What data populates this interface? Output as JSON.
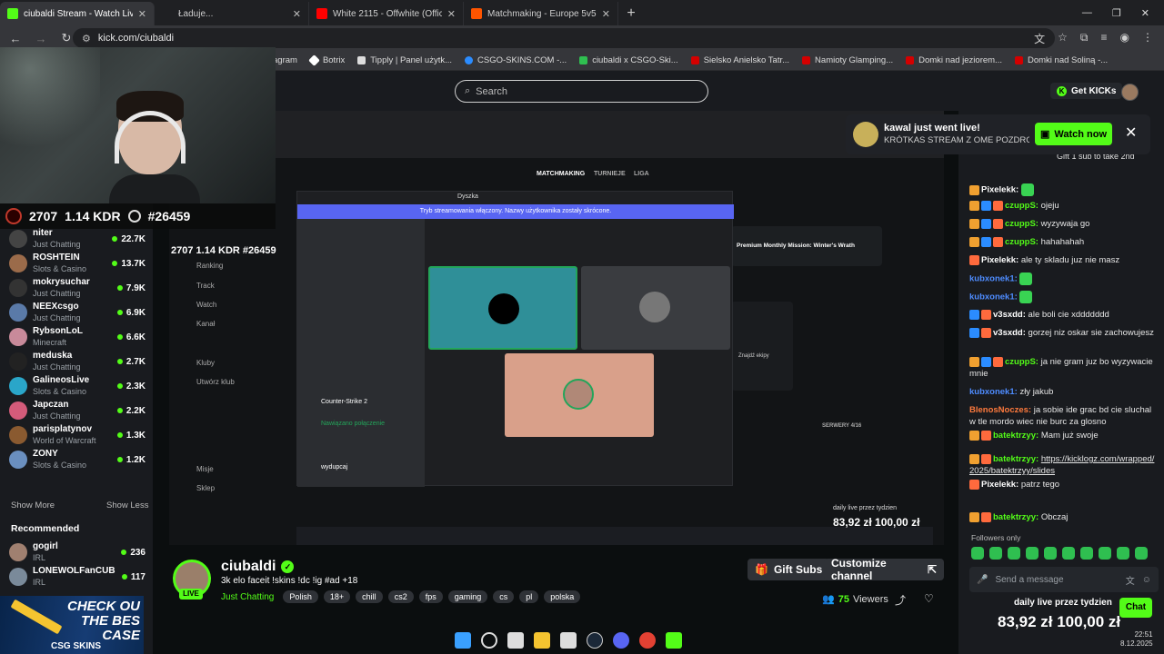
{
  "browser": {
    "tabs": [
      {
        "label": "ciubaldi Stream - Watch Live on",
        "color": "#53fc18",
        "active": true
      },
      {
        "label": "Ładuje...",
        "color": "#444",
        "active": false
      },
      {
        "label": "White 2115 - Offwhite (Offic",
        "color": "#ff0000",
        "active": false
      },
      {
        "label": "Matchmaking - Europe 5v5 Qu",
        "color": "#ff5500",
        "active": false
      }
    ],
    "url": "kick.com/ciubaldi",
    "bookmarks": [
      {
        "label": "agram",
        "color": "#c13584"
      },
      {
        "label": "Botrix",
        "color": "#fff"
      },
      {
        "label": "Tipply | Panel użytk...",
        "color": "#111"
      },
      {
        "label": "CSGO-SKINS.COM -...",
        "color": "#2b8cff"
      },
      {
        "label": "ciubaldi x CSGO-Ski...",
        "color": "#2fbf50"
      },
      {
        "label": "Sielsko Anielsko Tatr...",
        "color": "#d40000"
      },
      {
        "label": "Namioty Glamping...",
        "color": "#d40000"
      },
      {
        "label": "Domki nad jeziorem...",
        "color": "#d40000"
      },
      {
        "label": "Domki nad Soliną -...",
        "color": "#d40000"
      }
    ]
  },
  "kick": {
    "search_placeholder": "Search",
    "get_kicks": "Get KICKs"
  },
  "stream_overlay": {
    "elo": "2707",
    "kdr": "1.14 KDR",
    "rank": "#26459"
  },
  "sidebar": {
    "channels": [
      {
        "name": "niter",
        "category": "Just Chatting",
        "viewers": "22.7K",
        "color": "#444"
      },
      {
        "name": "ROSHTEIN",
        "category": "Slots & Casino",
        "viewers": "13.7K",
        "color": "#9b6b4a"
      },
      {
        "name": "mokrysuchar",
        "category": "Just Chatting",
        "viewers": "7.9K",
        "color": "#333"
      },
      {
        "name": "NEEXcsgo",
        "category": "Just Chatting",
        "viewers": "6.9K",
        "color": "#5a7aa8"
      },
      {
        "name": "RybsonLoL",
        "category": "Minecraft",
        "viewers": "6.6K",
        "color": "#c88a9a"
      },
      {
        "name": "meduska",
        "category": "Just Chatting",
        "viewers": "2.7K",
        "color": "#222"
      },
      {
        "name": "GalineosLive",
        "category": "Slots & Casino",
        "viewers": "2.3K",
        "color": "#2aa6c9"
      },
      {
        "name": "Japczan",
        "category": "Just Chatting",
        "viewers": "2.2K",
        "color": "#d45b7a"
      },
      {
        "name": "parisplatynov",
        "category": "World of Warcraft",
        "viewers": "1.3K",
        "color": "#8a5a30"
      },
      {
        "name": "ZONY",
        "category": "Slots & Casino",
        "viewers": "1.2K",
        "color": "#6a8fbf"
      }
    ],
    "show_more": "Show More",
    "show_less": "Show Less",
    "recommended_title": "Recommended",
    "recommended": [
      {
        "name": "gogirl",
        "category": "IRL",
        "viewers": "236",
        "color": "#a08070"
      },
      {
        "name": "LONEWOLFanCUB",
        "category": "IRL",
        "viewers": "117",
        "color": "#7a8a9a"
      }
    ]
  },
  "ad": {
    "line1": "CHECK OU",
    "line2": "THE BES",
    "line3": "CASE",
    "brand": "CSG SKINS"
  },
  "channel": {
    "name": "ciubaldi",
    "live": "LIVE",
    "title": "3k elo faceit !skins !dc !ig #ad +18",
    "category": "Just Chatting",
    "tags": [
      "Polish",
      "18+",
      "chill",
      "cs2",
      "fps",
      "gaming",
      "cs",
      "pl",
      "polska"
    ],
    "gift_subs": "Gift Subs",
    "customize": "Customize channel",
    "viewers_count": "75",
    "viewers_label": "Viewers"
  },
  "notification": {
    "title": "kawal just went live!",
    "subtitle": "KRÓTKAS STREAM Z OME POZDRO...",
    "watch_now": "Watch now"
  },
  "chat": {
    "gift_text": "Gift 1 sub to take 2nd",
    "messages": [
      {
        "user": "Pixelekk:",
        "color": "#ffffff",
        "text": "",
        "badges": [
          "#f0a030"
        ],
        "emote": true
      },
      {
        "user": "czuppS:",
        "color": "#53fc18",
        "text": "ojeju",
        "badges": [
          "#f0a030",
          "#2b8cff",
          "#ff6a3d"
        ]
      },
      {
        "user": "czuppS:",
        "color": "#53fc18",
        "text": "wyzywaja go",
        "badges": [
          "#f0a030",
          "#2b8cff",
          "#ff6a3d"
        ]
      },
      {
        "user": "czuppS:",
        "color": "#53fc18",
        "text": "hahahahah",
        "badges": [
          "#f0a030",
          "#2b8cff",
          "#ff6a3d"
        ]
      },
      {
        "user": "Pixelekk:",
        "color": "#ffffff",
        "text": "ale ty skladu juz nie masz",
        "badges": [
          "#ff6a3d"
        ]
      },
      {
        "user": "kubxonek1:",
        "color": "#4e8cff",
        "text": "",
        "badges": [],
        "emote": true
      },
      {
        "user": "kubxonek1:",
        "color": "#4e8cff",
        "text": "",
        "badges": [],
        "emote": true
      },
      {
        "user": "v3sxdd:",
        "color": "#ffffff",
        "text": "ale boli cie xddddddd",
        "badges": [
          "#2b8cff",
          "#ff6a3d"
        ]
      },
      {
        "user": "v3sxdd:",
        "color": "#ffffff",
        "text": "gorzej niz oskar sie zachowujesz",
        "badges": [
          "#2b8cff",
          "#ff6a3d"
        ]
      },
      {
        "user": "czuppS:",
        "color": "#53fc18",
        "text": "ja nie gram juz bo wyzywacie mnie",
        "badges": [
          "#f0a030",
          "#2b8cff",
          "#ff6a3d"
        ]
      },
      {
        "user": "kubxonek1:",
        "color": "#4e8cff",
        "text": "zły jakub",
        "badges": []
      },
      {
        "user": "BlenosNoczes:",
        "color": "#ff7a3d",
        "text": "ja sobie ide grac bd cie sluchal w tle mordo wiec nie burc za glosno",
        "badges": []
      },
      {
        "user": "batektrzyy:",
        "color": "#53fc18",
        "text": "Mam już swoje",
        "badges": [
          "#f0a030",
          "#ff6a3d"
        ]
      },
      {
        "user": "batektrzyy:",
        "color": "#53fc18",
        "text": "https://kicklogz.com/wrapped/2025/batektrzyy/slides",
        "badges": [
          "#f0a030",
          "#ff6a3d"
        ]
      },
      {
        "user": "Pixelekk:",
        "color": "#ffffff",
        "text": "patrz tego",
        "badges": [
          "#ff6a3d"
        ]
      },
      {
        "user": "batektrzyy:",
        "color": "#53fc18",
        "text": "Obczaj",
        "badges": [
          "#f0a030",
          "#ff6a3d"
        ]
      }
    ],
    "followers_only": "Followers only",
    "send_placeholder": "Send a message",
    "chat_button": "Chat"
  },
  "overlay_bottom": {
    "daily": "daily live przez tydzien",
    "price": "83,92 zł  100,00 zł"
  },
  "clock": {
    "time": "22:51",
    "date": "8.12.2025"
  },
  "inner": {
    "nav1": "MATCHMAKING",
    "nav2": "TURNIEJE",
    "nav3": "LIGA",
    "discord_title": "Dyszka",
    "banner": "Tryb streamowania włączony. Nazwy użytkownika zostały skrócone.",
    "mission": "Premium Monthly Mission: Winter's Wrath",
    "serwery": "SERWERY 4/16",
    "znajdz": "Znajdź ekipy",
    "kick_menu": [
      "Ranking",
      "Track",
      "Watch",
      "Kanał",
      "Kluby",
      "Utwórz klub",
      "Misje",
      "Sklep"
    ],
    "voice_channel": "Counter-Strike 2",
    "connected": "Nawiązano połączenie",
    "user": "wydupcaj"
  }
}
